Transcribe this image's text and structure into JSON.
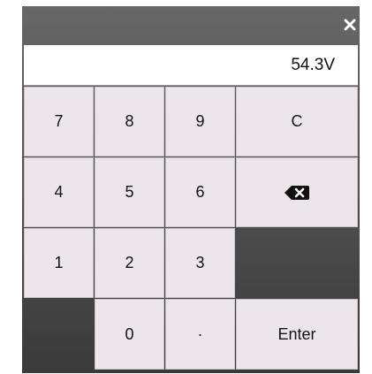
{
  "display": {
    "value": "54.3V"
  },
  "keys": {
    "seven": "7",
    "eight": "8",
    "nine": "9",
    "clear": "C",
    "four": "4",
    "five": "5",
    "six": "6",
    "one": "1",
    "two": "2",
    "three": "3",
    "zero": "0",
    "decimal": "·",
    "enter": "Enter"
  },
  "icons": {
    "close": "close-icon",
    "backspace": "backspace-icon"
  },
  "colors": {
    "panel_top": "#676767",
    "panel_bottom": "#3a3a3a",
    "key_background": "#ece6ea",
    "display_background": "#ffffff"
  }
}
